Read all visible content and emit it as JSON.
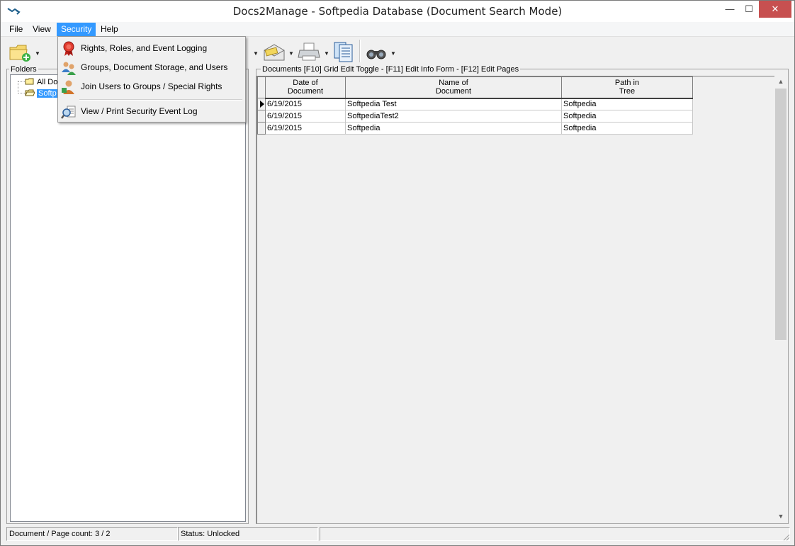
{
  "window": {
    "title": "Docs2Manage - Softpedia Database (Document Search Mode)",
    "minimize_glyph": "—",
    "maximize_glyph": "☐",
    "close_glyph": "✕"
  },
  "menubar": {
    "items": [
      {
        "label": "File"
      },
      {
        "label": "View"
      },
      {
        "label": "Security",
        "active": true
      },
      {
        "label": "Help"
      }
    ]
  },
  "security_menu": {
    "items": [
      {
        "label": "Rights, Roles, and Event Logging",
        "icon": "ribbon-award-icon"
      },
      {
        "label": "Groups, Document Storage, and Users",
        "icon": "users-group-icon"
      },
      {
        "label": "Join Users to Groups / Special Rights",
        "icon": "user-join-icon"
      },
      {
        "label": "View / Print Security Event Log",
        "icon": "magnifier-log-icon"
      }
    ]
  },
  "toolbar": {
    "buttons": [
      "new-folder-icon",
      "email-icon",
      "printer-icon",
      "document-pages-icon",
      "binoculars-icon"
    ]
  },
  "folders": {
    "label": "Folders",
    "tree": [
      {
        "label": "All Do",
        "selected": false
      },
      {
        "label": "Softp",
        "selected": true
      }
    ]
  },
  "documents": {
    "label": "Documents  [F10] Grid Edit Toggle - [F11] Edit Info Form - [F12] Edit Pages",
    "columns": [
      {
        "line1": "Date of",
        "line2": "Document"
      },
      {
        "line1": "Name of",
        "line2": "Document"
      },
      {
        "line1": "Path in",
        "line2": "Tree"
      }
    ],
    "rows": [
      {
        "date": "6/19/2015",
        "name": "Softpedia Test",
        "path": "Softpedia",
        "current": true
      },
      {
        "date": "6/19/2015",
        "name": "SoftpediaTest2",
        "path": "Softpedia",
        "current": false
      },
      {
        "date": "6/19/2015",
        "name": "Softpedia",
        "path": "Softpedia",
        "current": false
      }
    ]
  },
  "statusbar": {
    "count": "Document / Page count: 3 / 2",
    "status": "Status: Unlocked"
  },
  "colors": {
    "menu_highlight": "#3399ff",
    "close_button": "#c75050",
    "tree_selection": "#3399ff"
  }
}
